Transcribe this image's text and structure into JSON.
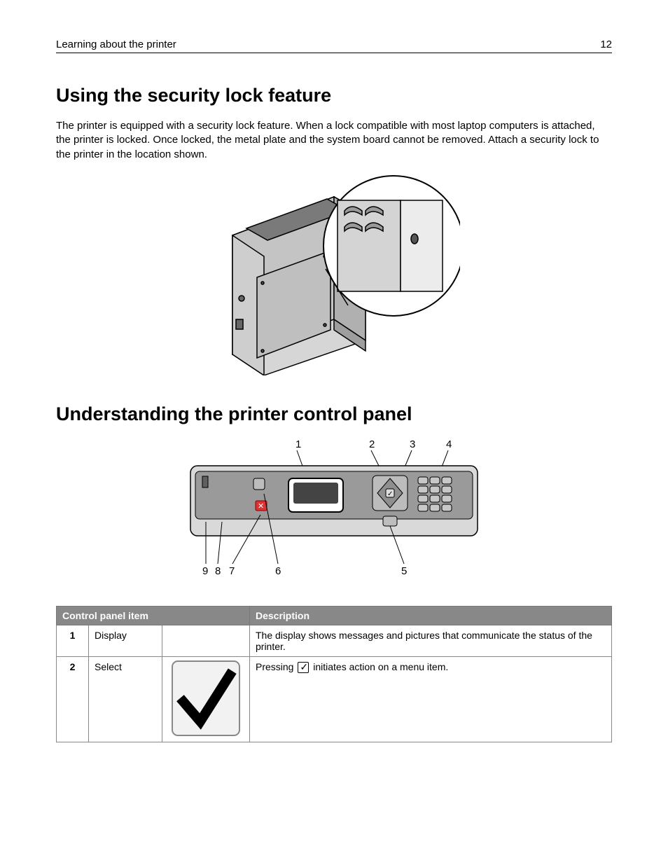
{
  "header": {
    "left": "Learning about the printer",
    "right": "12"
  },
  "section1": {
    "title": "Using the security lock feature",
    "body": "The printer is equipped with a security lock feature. When a lock compatible with most laptop computers is attached, the printer is locked. Once locked, the metal plate and the system board cannot be removed. Attach a security lock to the printer in the location shown."
  },
  "section2": {
    "title": "Understanding the printer control panel"
  },
  "panel_callouts": {
    "top": [
      "1",
      "2",
      "3",
      "4"
    ],
    "bottom": [
      "9",
      "8",
      "7",
      "6",
      "5"
    ]
  },
  "table": {
    "headers": {
      "item": "Control panel item",
      "desc": "Description"
    },
    "rows": [
      {
        "num": "1",
        "name": "Display",
        "icon": "none",
        "desc": "The display shows messages and pictures that communicate the status of the printer."
      },
      {
        "num": "2",
        "name": "Select",
        "icon": "check",
        "desc_pre": "Pressing ",
        "desc_post": " initiates action on a menu item."
      }
    ]
  }
}
